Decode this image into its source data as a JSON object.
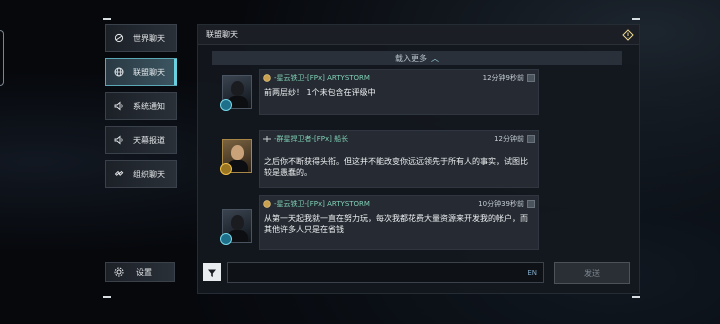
{
  "sidebar": {
    "items": [
      {
        "label": "世界聊天",
        "icon": "globe-chat-icon",
        "active": false
      },
      {
        "label": "联盟聊天",
        "icon": "alliance-globe-icon",
        "active": true
      },
      {
        "label": "系统通知",
        "icon": "speaker-icon",
        "active": false
      },
      {
        "label": "天幕报道",
        "icon": "speaker-icon",
        "active": false
      },
      {
        "label": "组织聊天",
        "icon": "link-icon",
        "active": false
      }
    ],
    "settings_label": "设置"
  },
  "panel": {
    "title": "联盟聊天",
    "load_more": "载入更多"
  },
  "messages": [
    {
      "name": "-星云铁卫-[FPx] ARTYSTORM",
      "time": "12分钟9秒前",
      "text": "前两层纱！ 1个未包含在评级中",
      "avatar": "dark"
    },
    {
      "name": "-群星捍卫者-[FPx] 船长",
      "time": "12分钟前",
      "text": "之后你不断获得头衔。但这并不能改变你远远领先于所有人的事实，试图比较是愚蠢的。",
      "avatar": "gold"
    },
    {
      "name": "-星云铁卫-[FPx] ARTYSTORM",
      "time": "10分钟39秒前",
      "text": "从第一天起我就一直在努力玩，每次我都花费大量资源来开发我的帐户，而其他许多人只是在省钱",
      "avatar": "dark"
    }
  ],
  "input": {
    "lang": "EN",
    "send_label": "发送"
  },
  "colors": {
    "accent": "#69d1e0",
    "name_green": "#7fd0b5"
  }
}
